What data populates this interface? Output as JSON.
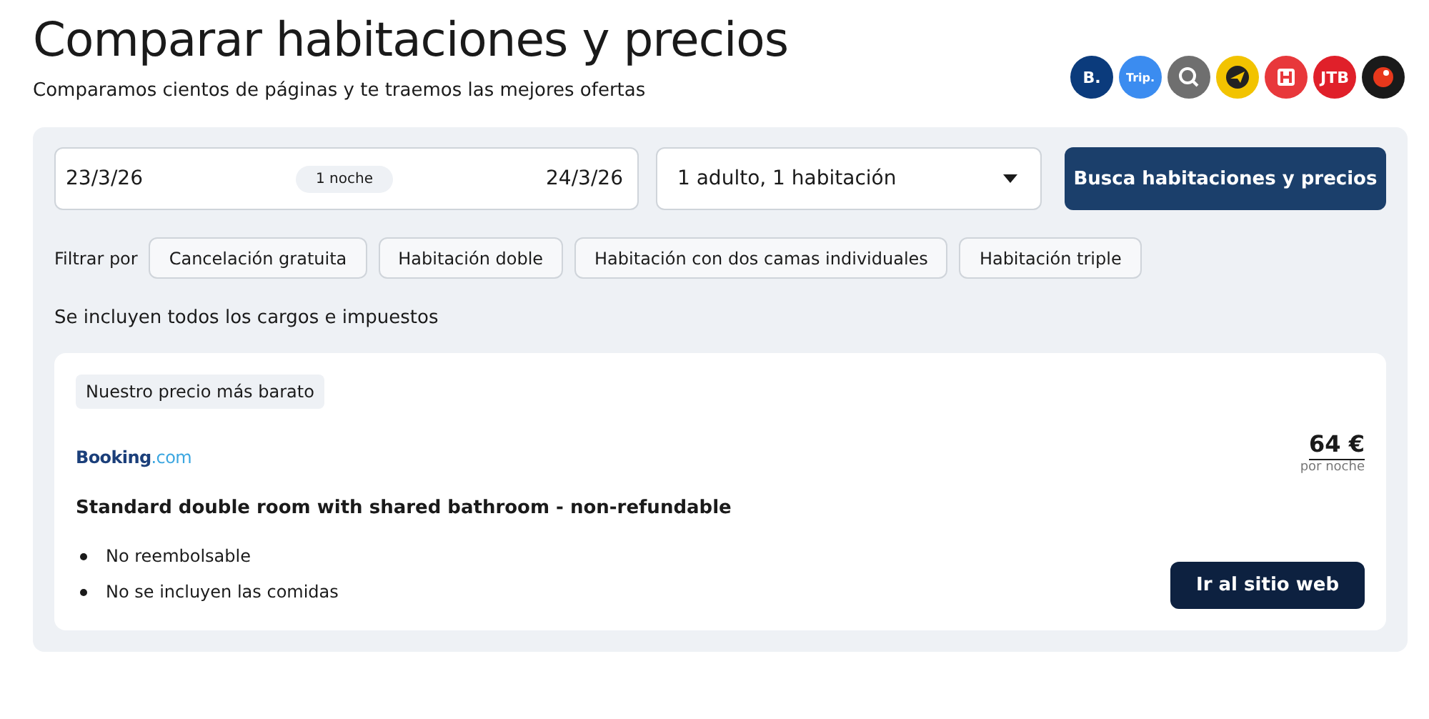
{
  "header": {
    "title": "Comparar habitaciones y precios",
    "subtitle": "Comparamos cientos de páginas y te traemos las mejores ofertas"
  },
  "partners": [
    {
      "kind": "text",
      "label": "B.",
      "color": "#0b3b7c"
    },
    {
      "kind": "text",
      "label": "Trip.",
      "color": "#3b8cf0"
    },
    {
      "kind": "search",
      "color": "#6f6f6f"
    },
    {
      "kind": "plane",
      "color": "#f2c300"
    },
    {
      "kind": "hotel",
      "color": "#e8383b"
    },
    {
      "kind": "text",
      "label": "JTB",
      "color": "#e0202a"
    },
    {
      "kind": "dot",
      "color": "#1a1a1a"
    }
  ],
  "search": {
    "checkin": "23/3/26",
    "nights": "1 noche",
    "checkout": "24/3/26",
    "guests": "1 adulto, 1 habitación",
    "button": "Busca habitaciones y precios"
  },
  "filters": {
    "label": "Filtrar por",
    "chips": [
      {
        "label": "Cancelación gratuita",
        "selected": false
      },
      {
        "label": "Habitación doble",
        "selected": false
      },
      {
        "label": "Habitación con dos camas individuales",
        "selected": false
      },
      {
        "label": "Habitación triple",
        "selected": false
      }
    ]
  },
  "note": "Se incluyen todos los cargos e impuestos",
  "offer": {
    "badge": "Nuestro precio más barato",
    "brand": {
      "name": "Booking",
      "suffix": ".com"
    },
    "price": "64 €",
    "price_unit": "por noche",
    "room": "Standard double room with shared bathroom - non-refundable",
    "features": [
      "No reembolsable",
      "No se incluyen las comidas"
    ],
    "button": "Ir al sitio web"
  }
}
